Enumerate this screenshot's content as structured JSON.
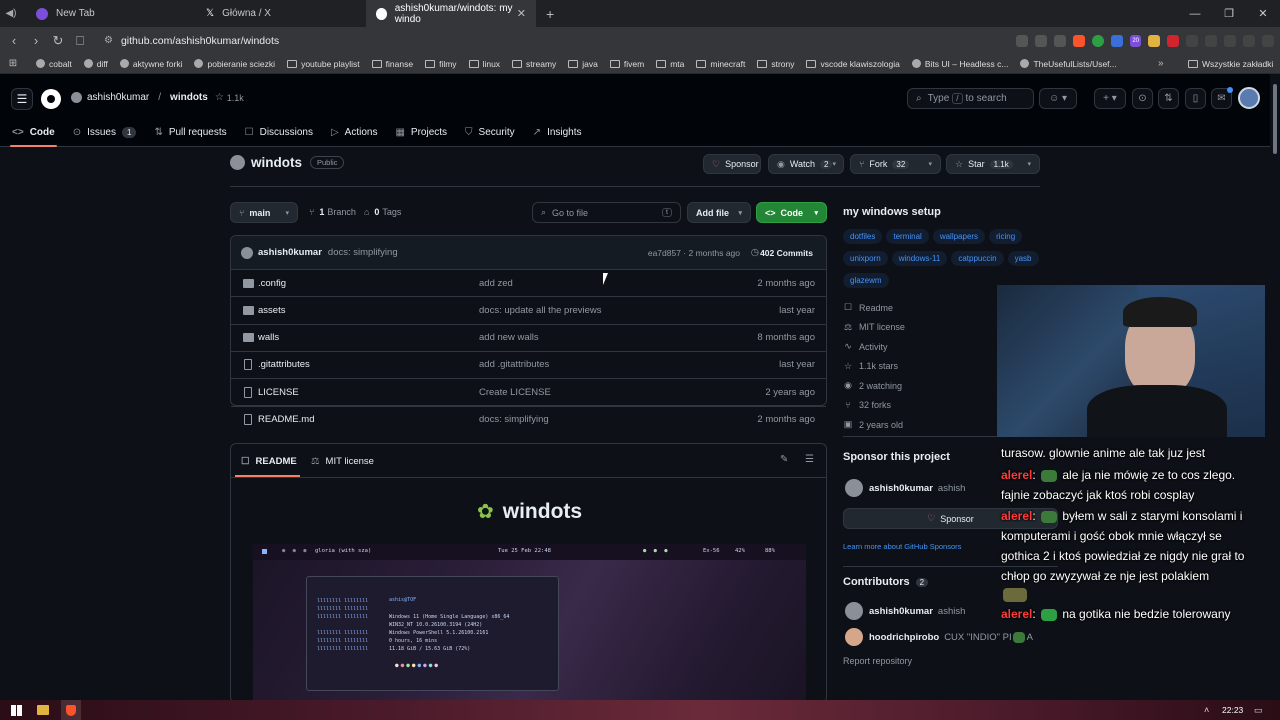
{
  "browser": {
    "tabs": [
      {
        "title": "New Tab",
        "color": "#7b4fd9"
      },
      {
        "title": "Główna / X",
        "color": "#000000"
      },
      {
        "title": "ashish0kumar/windots: my windo",
        "color": "#ffffff"
      }
    ],
    "url": "github.com/ashish0kumar/windots",
    "bookmarks": [
      "cobalt",
      "diff",
      "aktywne forki",
      "pobieranie sciezki",
      "youtube playlist",
      "finanse",
      "filmy",
      "linux",
      "streamy",
      "java",
      "fivem",
      "mta",
      "minecraft",
      "strony",
      "vscode klawiszologia",
      "Bits UI – Headless c...",
      "TheUsefulLists/Usef..."
    ],
    "bookmarks_overflow": "»",
    "all_bookmarks": "Wszystkie zakładki",
    "ext_badge": "20"
  },
  "header": {
    "owner": "ashish0kumar",
    "separator": "/",
    "repo": "windots",
    "stars": "1.1k",
    "search_prefix": "Type",
    "search_key": "/",
    "search_suffix": "to search",
    "nav": [
      {
        "label": "Code",
        "icon": "<>",
        "active": true
      },
      {
        "label": "Issues",
        "icon": "⊙",
        "count": "1"
      },
      {
        "label": "Pull requests",
        "icon": "⇅"
      },
      {
        "label": "Discussions",
        "icon": "☐"
      },
      {
        "label": "Actions",
        "icon": "▷"
      },
      {
        "label": "Projects",
        "icon": "▦"
      },
      {
        "label": "Security",
        "icon": "⛉"
      },
      {
        "label": "Insights",
        "icon": "↗"
      }
    ]
  },
  "repo": {
    "name": "windots",
    "visibility": "Public",
    "sponsor": "Sponsor",
    "watch": "Watch",
    "watch_count": "2",
    "fork": "Fork",
    "fork_count": "32",
    "star": "Star",
    "star_count": "1.1k",
    "branch": "main",
    "branches_num": "1",
    "branches_label": "Branch",
    "tags_num": "0",
    "tags_label": "Tags",
    "goto_placeholder": "Go to file",
    "goto_key": "t",
    "add_file": "Add file",
    "code_btn": "Code",
    "commit": {
      "author": "ashish0kumar",
      "message": "docs: simplifying",
      "hash_time": "ea7d857 · 2 months ago",
      "count": "402 Commits"
    },
    "files": [
      {
        "name": ".config",
        "type": "dir",
        "msg": "add zed",
        "date": "2 months ago"
      },
      {
        "name": "assets",
        "type": "dir",
        "msg": "docs: update all the previews",
        "date": "last year"
      },
      {
        "name": "walls",
        "type": "dir",
        "msg": "add new walls",
        "date": "8 months ago"
      },
      {
        "name": ".gitattributes",
        "type": "file",
        "msg": "add .gitattributes",
        "date": "last year"
      },
      {
        "name": "LICENSE",
        "type": "file",
        "msg": "Create LICENSE",
        "date": "2 years ago"
      },
      {
        "name": "README.md",
        "type": "file",
        "msg": "docs: simplifying",
        "date": "2 months ago"
      }
    ],
    "readme_tab": "README",
    "license_tab": "MIT license",
    "readme_title": "windots",
    "preview": {
      "workspace": "gloria (with sza)",
      "date": "Tue 25 Feb 22:48",
      "ram": "Ex-56",
      "cpu": "42%",
      "disk": "88%",
      "user": "ashis@TOF",
      "sysinfo": [
        "Windows 11 (Home Single Language) x86_64",
        "WIN32_NT 10.0.26100.3194 (24H2)",
        "Windows PowerShell 5.1.26100.2161",
        "0 hours, 16 mins",
        "11.18 GiB / 15.63 GiB (72%)"
      ]
    }
  },
  "sidebar": {
    "about": "my windows setup",
    "topics": [
      "dotfiles",
      "terminal",
      "wallpapers",
      "ricing",
      "unixporn",
      "windows-11",
      "catppuccin",
      "yasb",
      "glazewm"
    ],
    "links": [
      {
        "icon": "☐",
        "label": "Readme"
      },
      {
        "icon": "⚖",
        "label": "MIT license"
      },
      {
        "icon": "∿",
        "label": "Activity"
      },
      {
        "icon": "☆",
        "label": "1.1k stars"
      },
      {
        "icon": "◉",
        "label": "2 watching"
      },
      {
        "icon": "⑂",
        "label": "32 forks"
      },
      {
        "icon": "▣",
        "label": "2 years old"
      }
    ],
    "sponsor_heading": "Sponsor this project",
    "sponsor_user": "ashish0kumar",
    "sponsor_user_sub": "ashish",
    "sponsor_btn": "Sponsor",
    "sponsor_link": "Learn more about GitHub Sponsors",
    "contributors_heading": "Contributors",
    "contributors_count": "2",
    "contrib1": "ashish0kumar",
    "contrib1_sub": "ashish",
    "contrib2": "hoodrichpirobo",
    "contrib2_sub": "CUX \"INDIO\" PI",
    "contrib2_tail": "A",
    "report": "Report repository"
  },
  "chat": {
    "lines": [
      {
        "text": "turasow. glownie anime ale tak juz jest"
      },
      {
        "user": "alerel",
        "text": "ale ja nie mówię ze to cos zlego. fajnie zobaczyć jak ktoś robi cosplay"
      },
      {
        "user": "alerel",
        "text": "byłem w sali z starymi konsolami i komputerami i gość obok mnie włączył se gothica 2 i ktoś powiedział ze nigdy nie grał to chłop go zwyzywał ze nje jest polakiem"
      },
      {
        "user": "alerel",
        "text": "na gotika nie bedzie tolerowany"
      }
    ]
  },
  "taskbar": {
    "time": "22:23"
  }
}
